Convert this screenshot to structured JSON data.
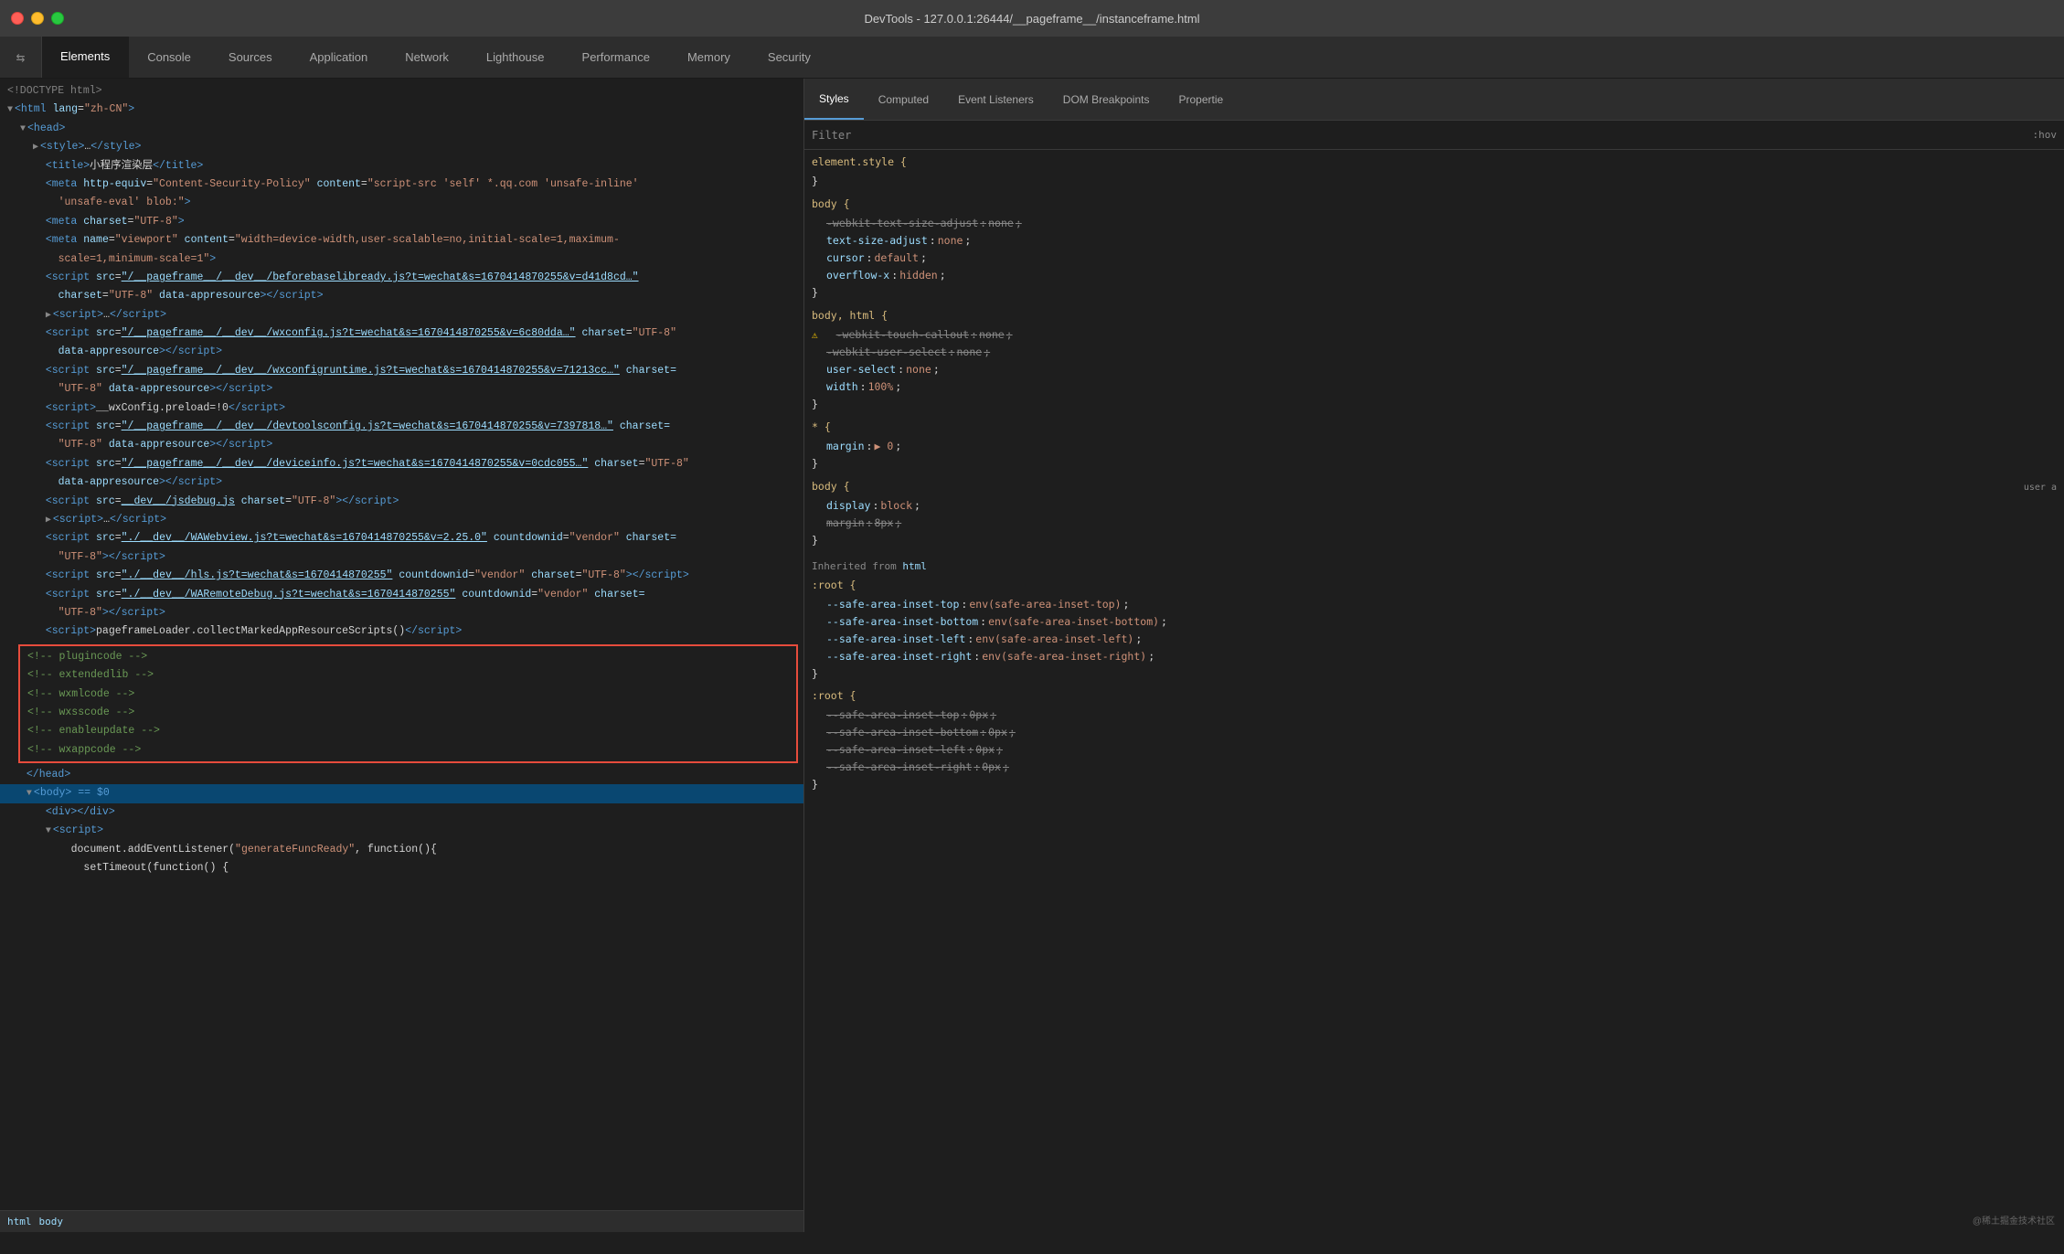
{
  "titleBar": {
    "title": "DevTools - 127.0.0.1:26444/__pageframe__/instanceframe.html"
  },
  "tabs": [
    {
      "id": "elements",
      "label": "Elements",
      "active": true
    },
    {
      "id": "console",
      "label": "Console",
      "active": false
    },
    {
      "id": "sources",
      "label": "Sources",
      "active": false
    },
    {
      "id": "application",
      "label": "Application",
      "active": false
    },
    {
      "id": "network",
      "label": "Network",
      "active": false
    },
    {
      "id": "lighthouse",
      "label": "Lighthouse",
      "active": false
    },
    {
      "id": "performance",
      "label": "Performance",
      "active": false
    },
    {
      "id": "memory",
      "label": "Memory",
      "active": false
    },
    {
      "id": "security",
      "label": "Security",
      "active": false
    }
  ],
  "stylesTabs": [
    {
      "id": "styles",
      "label": "Styles",
      "active": true
    },
    {
      "id": "computed",
      "label": "Computed",
      "active": false
    },
    {
      "id": "event-listeners",
      "label": "Event Listeners",
      "active": false
    },
    {
      "id": "dom-breakpoints",
      "label": "DOM Breakpoints",
      "active": false
    },
    {
      "id": "properties",
      "label": "Properties",
      "active": false
    }
  ],
  "filter": {
    "placeholder": "Filter",
    "hov": ":hov"
  },
  "breadcrumb": {
    "items": [
      "html",
      "body"
    ]
  },
  "watermark": "@稀土掘金技术社区"
}
